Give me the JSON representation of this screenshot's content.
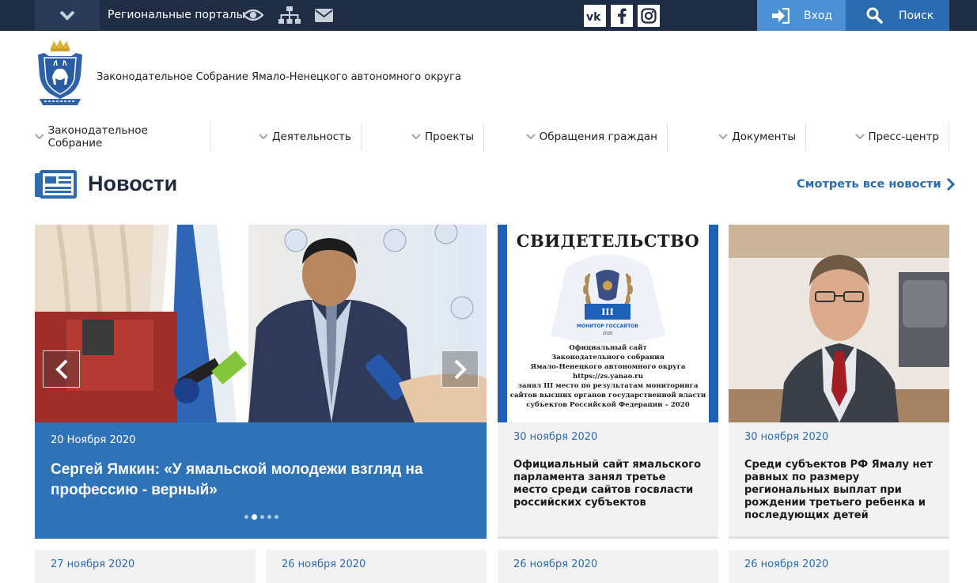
{
  "topbar": {
    "regional_portals": "Региональные порталы",
    "login": "Вход",
    "search": "Поиск",
    "social": [
      "vk-icon",
      "facebook-icon",
      "instagram-icon"
    ]
  },
  "header": {
    "org_title": "Законодательное Собрание Ямало-Ненецкого автономного округа"
  },
  "nav": {
    "items": [
      {
        "label": "Законодательное Собрание"
      },
      {
        "label": "Деятельность"
      },
      {
        "label": "Проекты"
      },
      {
        "label": "Обращения граждан"
      },
      {
        "label": "Документы"
      },
      {
        "label": "Пресс-центр"
      }
    ]
  },
  "news": {
    "title": "Новости",
    "all_link": "Смотреть все новости",
    "slider": {
      "date": "20 Ноября 2020",
      "title": "Сергей Ямкин: «У ямальской молодежи взгляд на профессию - верный»",
      "dots": 5,
      "active_dot": 1
    },
    "cards": [
      {
        "date": "30 ноября 2020",
        "text": "Официальный сайт ямальского парламента занял третье место среди сайтов госвласти российских субъектов",
        "cert_title": "СВИДЕТЕЛЬСТВО",
        "cert_badge_num": "III",
        "cert_badge_label": "МОНИТОР ГОССАЙТОВ",
        "cert_badge_year": "2020",
        "cert_body": [
          "Официальный сайт",
          "Законодательного собрания",
          "Ямало-Ненецкого автономного округа",
          "https://zs.yanao.ru",
          "занял III место по результатам мониторинга",
          "сайтов высших органов государственной власти",
          "субъектов Российской Федерации – 2020"
        ]
      },
      {
        "date": "30 ноября 2020",
        "text": "Среди субъектов РФ Ямалу нет равных по размеру региональных выплат при рождении третьего ребенка и последующих детей"
      }
    ],
    "row2_dates": [
      "27 ноября 2020",
      "26 ноября 2020",
      "26 ноября 2020",
      "26 ноября 2020"
    ]
  },
  "colors": {
    "topbar": "#1e2c44",
    "accent": "#2b6cb0",
    "login": "#4a90d2",
    "slider_bg": "#2e73b8"
  }
}
